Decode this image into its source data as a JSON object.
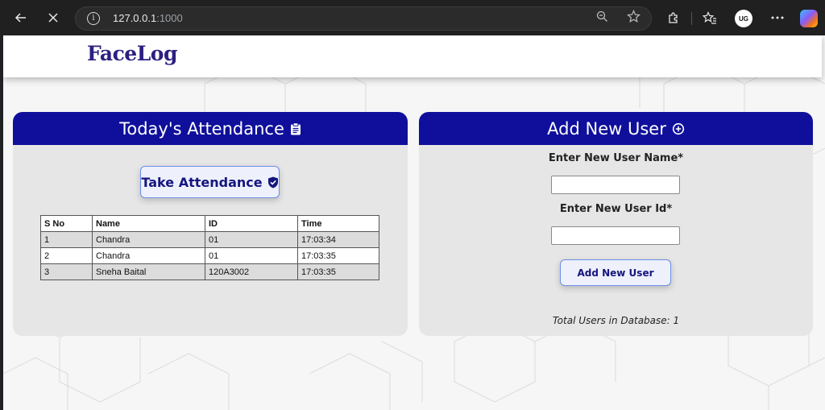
{
  "browser": {
    "url_host": "127.0.0.1",
    "url_port": ":1000",
    "avatar_text": "UG"
  },
  "navbar": {
    "brand": "FaceLog"
  },
  "attendance": {
    "title": "Today's Attendance",
    "title_icon": "clipboard-icon",
    "take_button": "Take Attendance",
    "take_button_icon": "shield-check-icon",
    "columns": [
      "S No",
      "Name",
      "ID",
      "Time"
    ],
    "rows": [
      {
        "sno": "1",
        "name": "Chandra",
        "id": "01",
        "time": "17:03:34"
      },
      {
        "sno": "2",
        "name": "Chandra",
        "id": "01",
        "time": "17:03:35"
      },
      {
        "sno": "3",
        "name": "Sneha Baital",
        "id": "120A3002",
        "time": "17:03:35"
      }
    ]
  },
  "add_user": {
    "title": "Add New User",
    "title_icon": "plus-circle-icon",
    "name_label": "Enter New User Name*",
    "name_value": "",
    "id_label": "Enter New User Id*",
    "id_value": "",
    "submit_button": "Add New User",
    "total_text": "Total Users in Database: 1"
  },
  "colors": {
    "header_blue": "#0f0f9c",
    "brand_purple": "#2c2080",
    "button_text": "#15157f",
    "button_border": "#6c8fe6"
  }
}
